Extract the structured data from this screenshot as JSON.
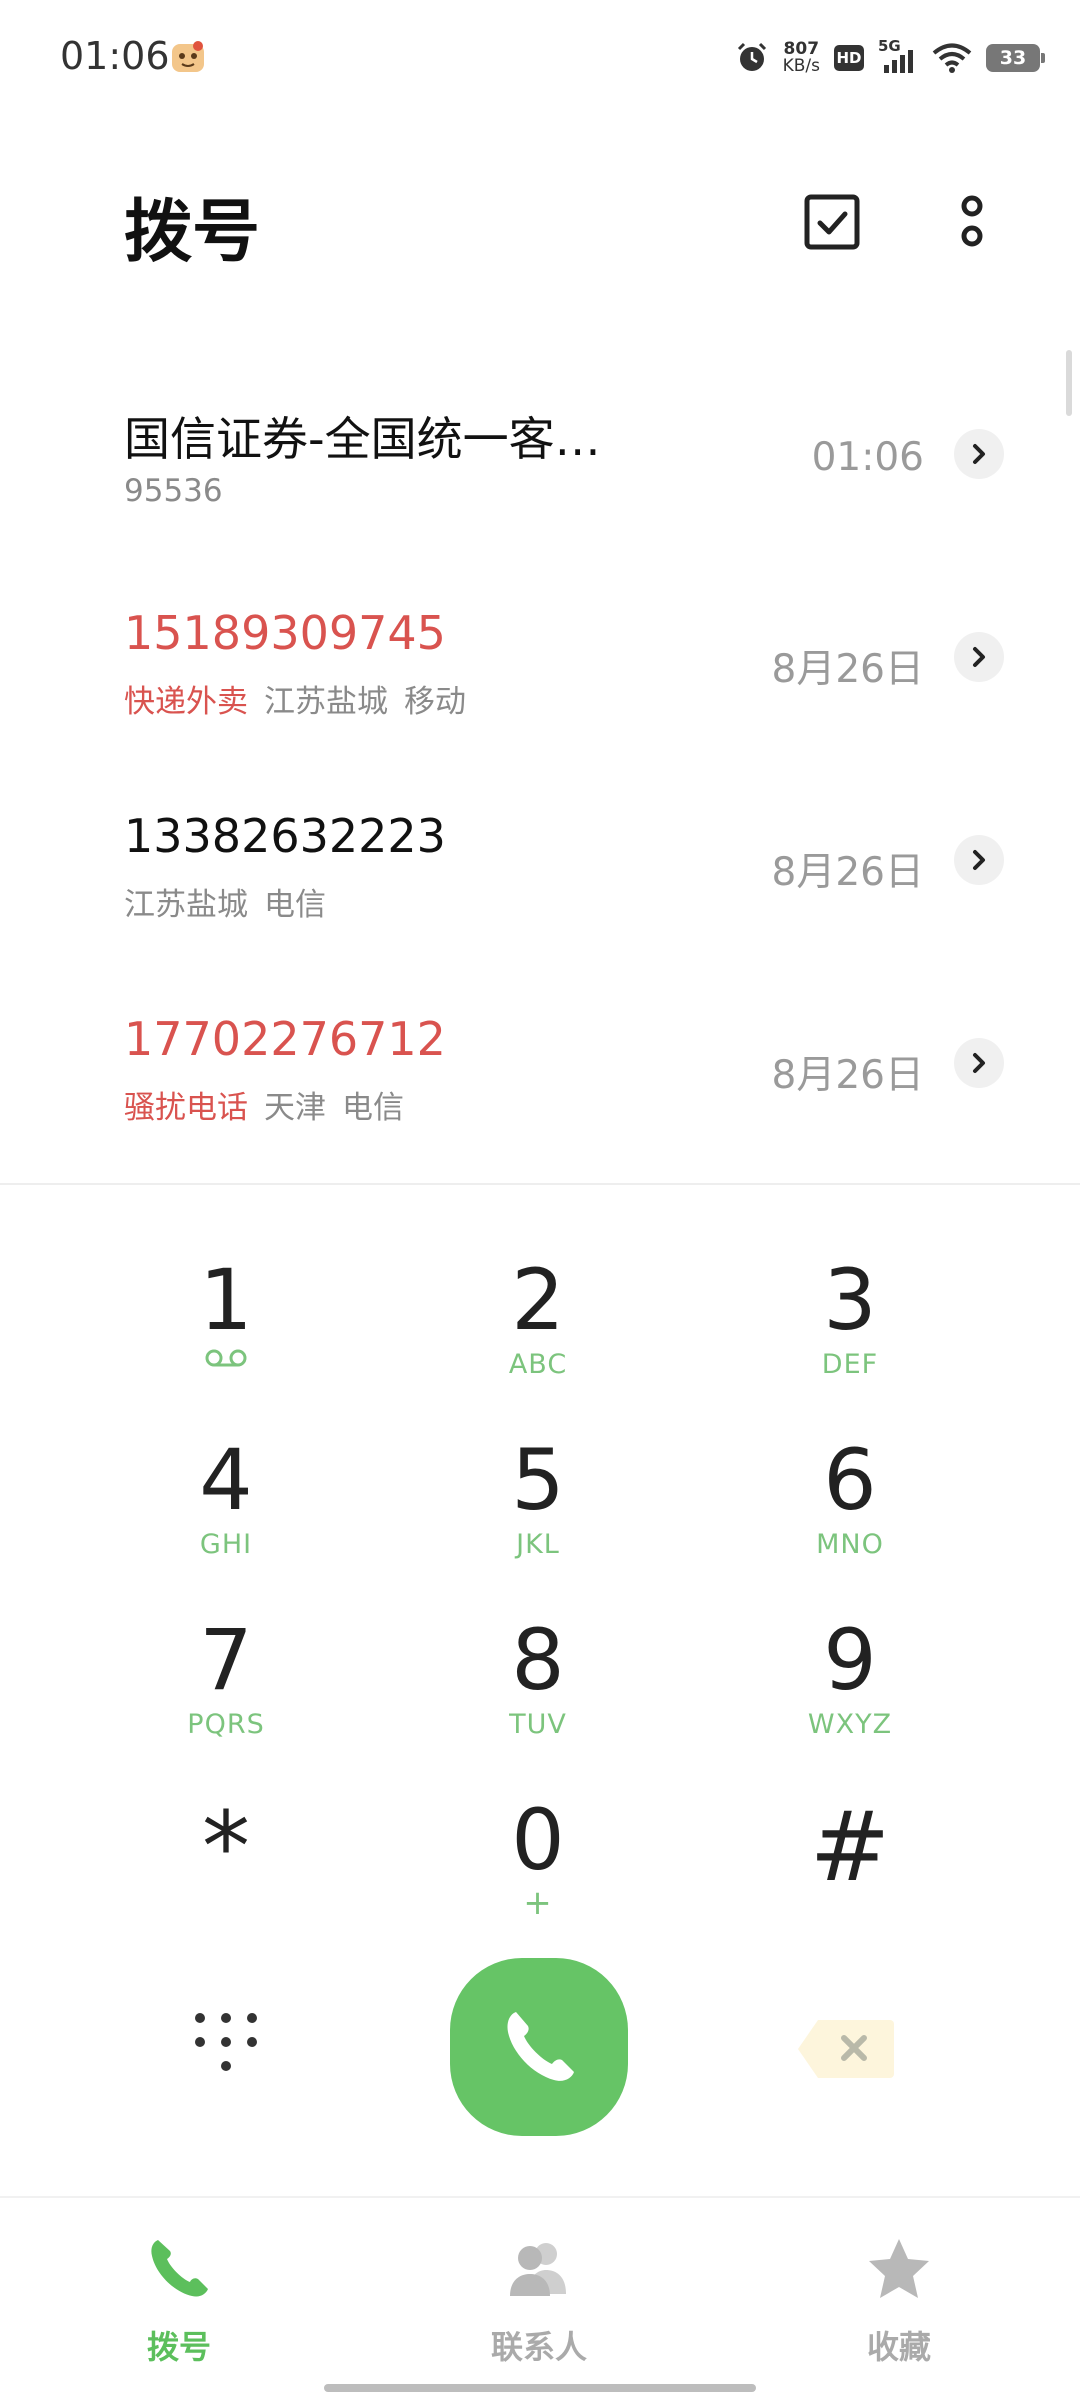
{
  "status_bar": {
    "time": "01:06",
    "network_speed_value": "807",
    "network_speed_unit": "KB/s",
    "hd_label": "HD",
    "signal_label": "5G",
    "battery": "33"
  },
  "header": {
    "title": "拨号",
    "icons": [
      "multi-select-icon",
      "more-options-icon"
    ]
  },
  "calls": [
    {
      "name": "国信证券-全国统一客…",
      "sub": [
        "95536"
      ],
      "time": "01:06",
      "name_color": "normal"
    },
    {
      "name": "15189309745",
      "tag": "快递外卖",
      "sub": [
        "江苏盐城",
        "移动"
      ],
      "time": "8月26日",
      "name_color": "red"
    },
    {
      "name": "13382632223",
      "sub": [
        "江苏盐城",
        "电信"
      ],
      "time": "8月26日",
      "name_color": "normal"
    },
    {
      "name": "17702276712",
      "tag": "骚扰电话",
      "sub": [
        "天津",
        "电信"
      ],
      "time": "8月26日",
      "name_color": "red"
    }
  ],
  "keypad": [
    {
      "digit": "1",
      "letters": ""
    },
    {
      "digit": "2",
      "letters": "ABC"
    },
    {
      "digit": "3",
      "letters": "DEF"
    },
    {
      "digit": "4",
      "letters": "GHI"
    },
    {
      "digit": "5",
      "letters": "JKL"
    },
    {
      "digit": "6",
      "letters": "MNO"
    },
    {
      "digit": "7",
      "letters": "PQRS"
    },
    {
      "digit": "8",
      "letters": "TUV"
    },
    {
      "digit": "9",
      "letters": "WXYZ"
    },
    {
      "digit": "*",
      "letters": ""
    },
    {
      "digit": "0",
      "letters": "+"
    },
    {
      "digit": "#",
      "letters": ""
    }
  ],
  "bottom_nav": [
    {
      "label": "拨号",
      "icon": "phone-icon",
      "active": true
    },
    {
      "label": "联系人",
      "icon": "contacts-icon",
      "active": false
    },
    {
      "label": "收藏",
      "icon": "star-icon",
      "active": false
    }
  ],
  "colors": {
    "accent_green": "#66c466",
    "warning_red": "#d9534f",
    "letters_green": "#7cc47d"
  }
}
